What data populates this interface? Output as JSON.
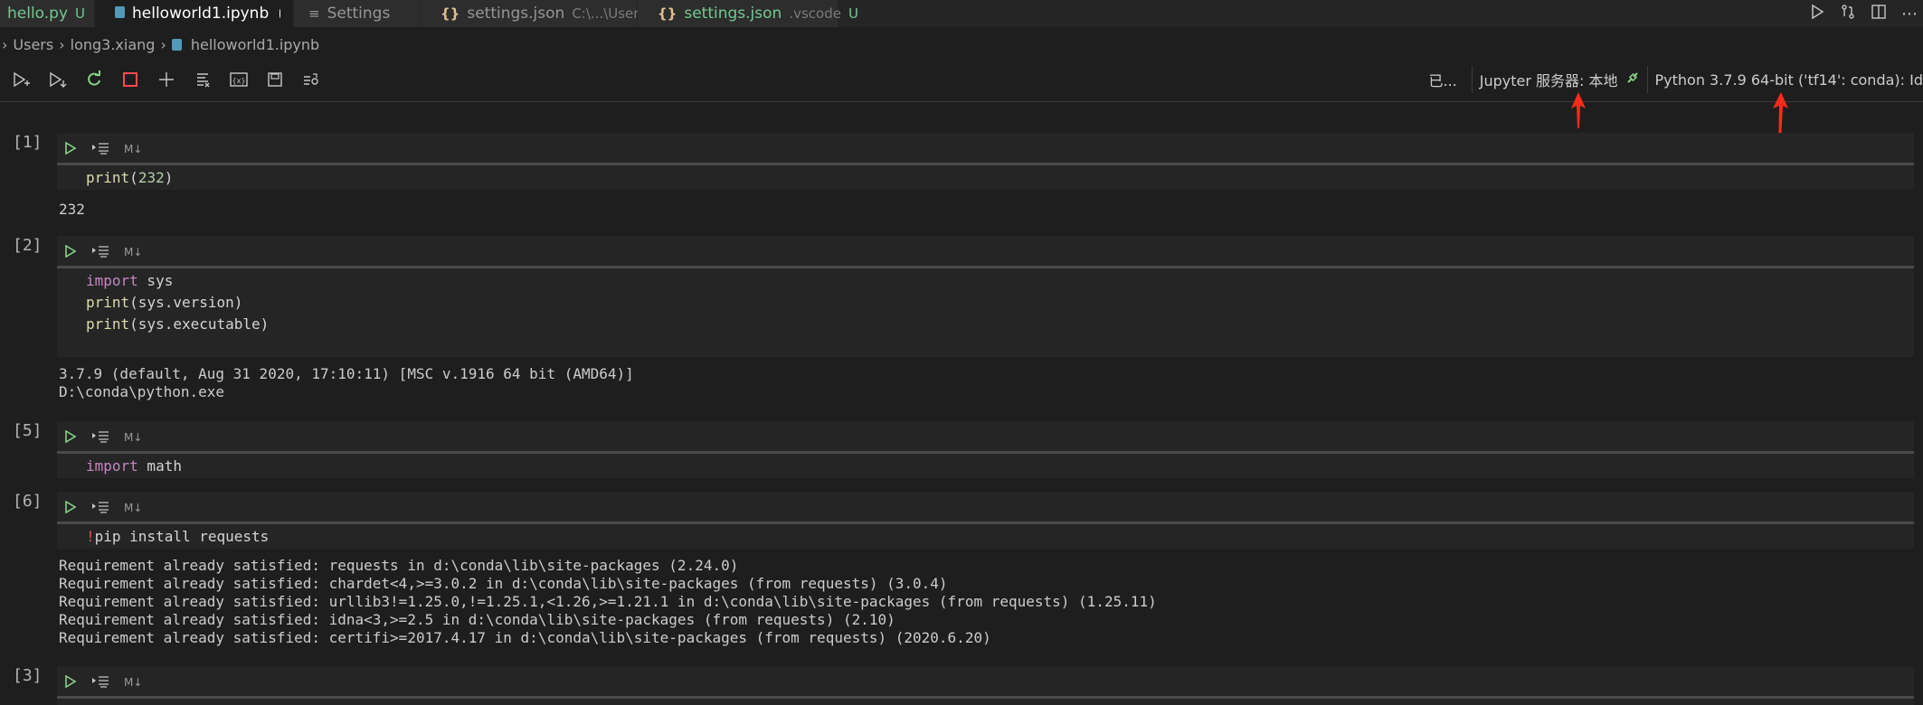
{
  "tabs": [
    {
      "label": "hello.py",
      "badge": "U",
      "icon": "python-file-icon",
      "active": false,
      "dot": false
    },
    {
      "label": "helloworld1.ipynb",
      "badge": "",
      "icon": "notebook-file-icon",
      "active": true,
      "dot": true
    },
    {
      "label": "Settings",
      "badge": "",
      "icon": "settings-list-icon",
      "active": false,
      "dot": false
    },
    {
      "label": "settings.json",
      "description": "C:\\...\\User",
      "badge": "",
      "icon": "json-icon",
      "active": false,
      "dot": true
    },
    {
      "label": "settings.json",
      "description": ".vscode",
      "badge": "U",
      "icon": "json-icon",
      "active": false,
      "dot": true
    }
  ],
  "breadcrumb": [
    "Users",
    "long3.xiang",
    "helloworld1.ipynb"
  ],
  "toolbar": {
    "trusted_label": "已...",
    "jupyter_server_label": "Jupyter 服务器: 本地",
    "kernel_label": "Python 3.7.9 64-bit ('tf14': conda): Id"
  },
  "cells": [
    {
      "count": "[1]",
      "md_label": "M↓",
      "code": [
        [
          {
            "t": "print",
            "c": "fn"
          },
          {
            "t": "(",
            "c": ""
          },
          {
            "t": "232",
            "c": "num"
          },
          {
            "t": ")",
            "c": ""
          }
        ]
      ],
      "output": [
        "232"
      ]
    },
    {
      "count": "[2]",
      "md_label": "M↓",
      "code": [
        [
          {
            "t": "import",
            "c": "kw"
          },
          {
            "t": " sys",
            "c": ""
          }
        ],
        [
          {
            "t": "print",
            "c": "fn"
          },
          {
            "t": "(sys.version)",
            "c": ""
          }
        ],
        [
          {
            "t": "print",
            "c": "fn"
          },
          {
            "t": "(sys.executable)",
            "c": ""
          }
        ]
      ],
      "output": [
        "3.7.9 (default, Aug 31 2020, 17:10:11) [MSC v.1916 64 bit (AMD64)]",
        "D:\\conda\\python.exe"
      ]
    },
    {
      "count": "[5]",
      "md_label": "M↓",
      "code": [
        [
          {
            "t": "import",
            "c": "kw"
          },
          {
            "t": " math",
            "c": ""
          }
        ]
      ],
      "output": []
    },
    {
      "count": "[6]",
      "md_label": "M↓",
      "code": [
        [
          {
            "t": "!",
            "c": "bang"
          },
          {
            "t": "pip install requests",
            "c": ""
          }
        ]
      ],
      "output": [
        "Requirement already satisfied: requests in d:\\conda\\lib\\site-packages (2.24.0)",
        "Requirement already satisfied: chardet<4,>=3.0.2 in d:\\conda\\lib\\site-packages (from requests) (3.0.4)",
        "Requirement already satisfied: urllib3!=1.25.0,!=1.25.1,<1.26,>=1.21.1 in d:\\conda\\lib\\site-packages (from requests) (1.25.11)",
        "Requirement already satisfied: idna<3,>=2.5 in d:\\conda\\lib\\site-packages (from requests) (2.10)",
        "Requirement already satisfied: certifi>=2017.4.17 in d:\\conda\\lib\\site-packages (from requests) (2020.6.20)"
      ]
    },
    {
      "count": "[3]",
      "md_label": "M↓",
      "code": [],
      "output": []
    }
  ],
  "colors": {
    "accent_green": "#73c991",
    "annotation_red": "#ff2a1a",
    "modified_dot": "#ffffff",
    "inactive_dot": "#8a8a8a"
  }
}
